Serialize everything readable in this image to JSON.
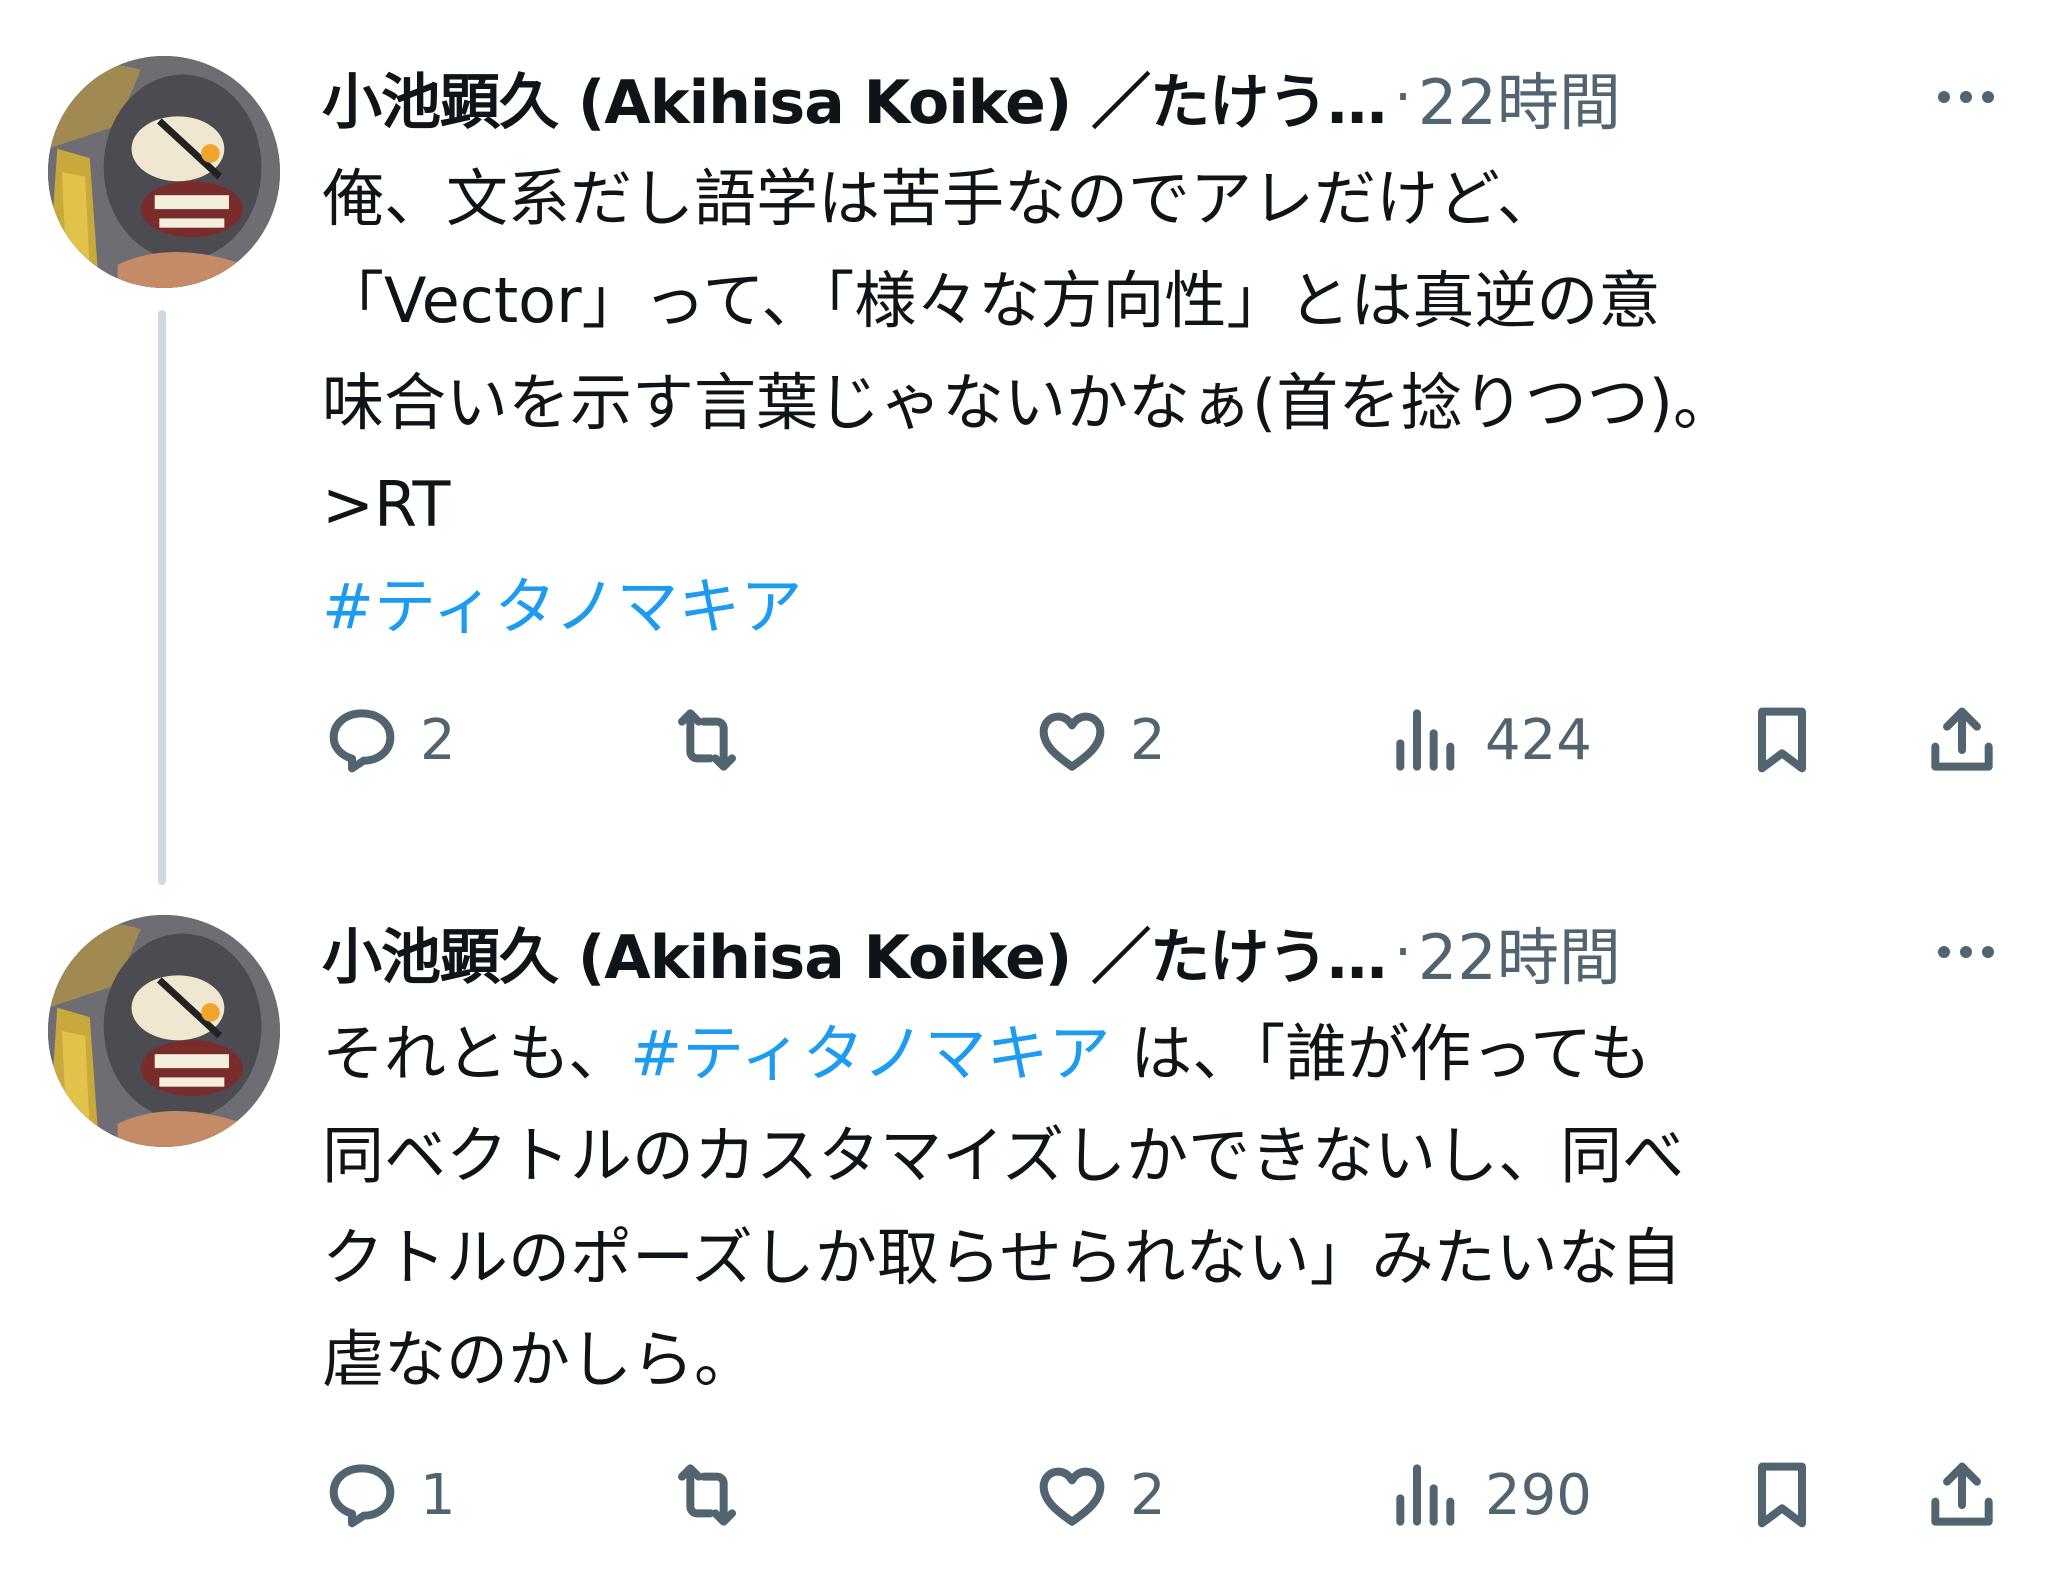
{
  "tweets": [
    {
      "author_name": "小池顕久 (Akihisa Koike) ／たけう…",
      "separator": "·",
      "time": "22時間",
      "lines": [
        [
          "俺、文系だし語学は苦手なのでアレだけど、"
        ],
        [
          "「Vector」って、「様々な方向性」とは真逆の意"
        ],
        [
          "味合いを示す言葉じゃないかなぁ(首を捻りつつ)。"
        ],
        [
          ">RT"
        ]
      ],
      "hashtag_line": "#ティタノマキア",
      "replies": "2",
      "reposts": "",
      "likes": "2",
      "views": "424"
    },
    {
      "author_name": "小池顕久 (Akihisa Koike) ／たけう…",
      "separator": "·",
      "time": "22時間",
      "line1_before": "それとも、",
      "line1_hashtag": "#ティタノマキア",
      "line1_after": " は、「誰が作っても",
      "lines": [
        "同ベクトルのカスタマイズしかできないし、同べ",
        "クトルのポーズしか取らせられない」みたいな自",
        "虐なのかしら。"
      ],
      "replies": "1",
      "reposts": "",
      "likes": "2",
      "views": "290"
    }
  ],
  "icons": [
    "gorilla-avatar",
    "more-icon",
    "reply-icon",
    "repost-icon",
    "like-icon",
    "views-icon",
    "bookmark-icon",
    "share-icon"
  ],
  "colors": {
    "link": "#1d9bf0",
    "muted": "#536471",
    "text": "#0f1419",
    "thread_line": "#cfd9de"
  }
}
